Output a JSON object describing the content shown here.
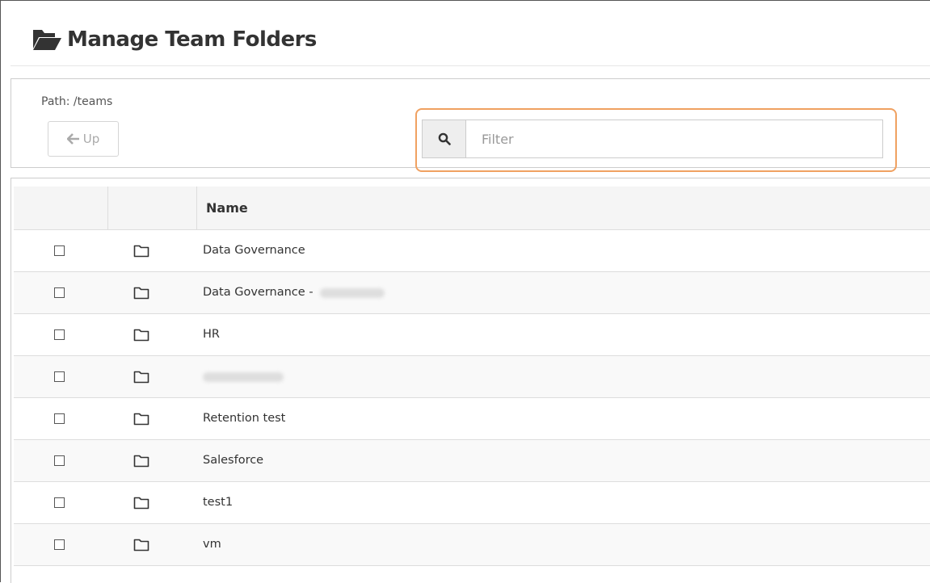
{
  "page": {
    "title": "Manage Team Folders",
    "title_icon": "folder-open-icon"
  },
  "toolbar": {
    "path_label": "Path: /teams",
    "up_button_label": "Up",
    "up_icon": "arrow-left-icon"
  },
  "filter": {
    "placeholder": "Filter",
    "value": "",
    "icon": "search-icon",
    "highlight_color": "#f0a161"
  },
  "table": {
    "columns": [
      "",
      "",
      "Name"
    ],
    "rows": [
      {
        "name": "Data Governance",
        "redacted": false
      },
      {
        "name": "Data Governance - ",
        "redacted": true
      },
      {
        "name": "HR",
        "redacted": false
      },
      {
        "name": "",
        "redacted": true
      },
      {
        "name": "Retention test",
        "redacted": false
      },
      {
        "name": "Salesforce",
        "redacted": false
      },
      {
        "name": "test1",
        "redacted": false
      },
      {
        "name": "vm",
        "redacted": false
      }
    ],
    "row_icon": "folder-icon"
  }
}
